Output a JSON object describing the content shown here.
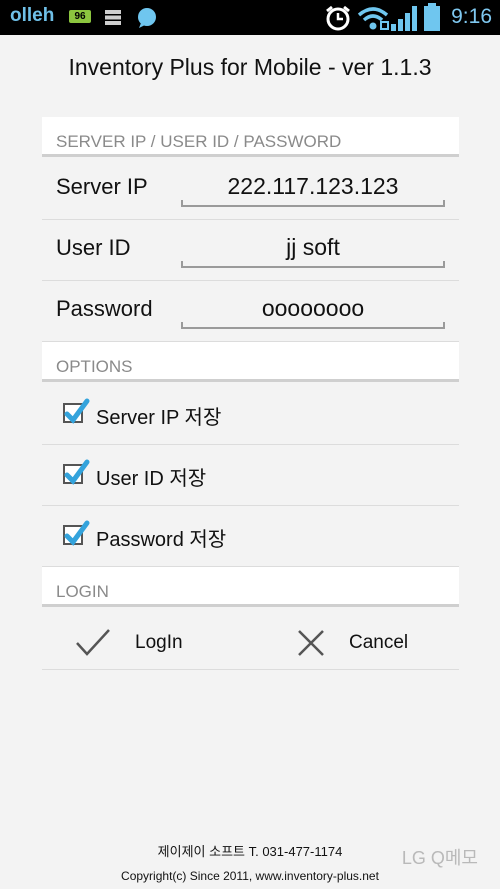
{
  "status_bar": {
    "carrier": "olleh",
    "battery_badge": "96",
    "time": "9:16",
    "icons": [
      "battery-level-icon",
      "storage-icon",
      "chat-bubble-icon",
      "alarm-clock-icon",
      "wifi-icon",
      "signal-icon",
      "battery-icon"
    ]
  },
  "app": {
    "title": "Inventory Plus for Mobile - ver 1.1.3"
  },
  "sections": {
    "server": "SERVER IP / USER ID / PASSWORD",
    "options": "OPTIONS",
    "login": "LOGIN"
  },
  "fields": {
    "server_ip": {
      "label": "Server IP",
      "value": "222.117.123.123"
    },
    "user_id": {
      "label": "User ID",
      "value": "jj soft"
    },
    "password": {
      "label": "Password",
      "value": "oooooooo"
    }
  },
  "options": [
    {
      "label": "Server IP 저장",
      "checked": true
    },
    {
      "label": "User ID 저장",
      "checked": true
    },
    {
      "label": "Password 저장",
      "checked": true
    }
  ],
  "buttons": {
    "login": "LogIn",
    "cancel": "Cancel"
  },
  "footer": {
    "company": "제이제이 소프트 T. 031-477-1174",
    "copyright": "Copyright(c) Since 2011,  www.inventory-plus.net"
  },
  "watermark": "LG Q메모",
  "colors": {
    "checkbox_check": "#33a3dc",
    "clock": "#7fc8f0",
    "section_header_text": "#8a8a8a"
  }
}
